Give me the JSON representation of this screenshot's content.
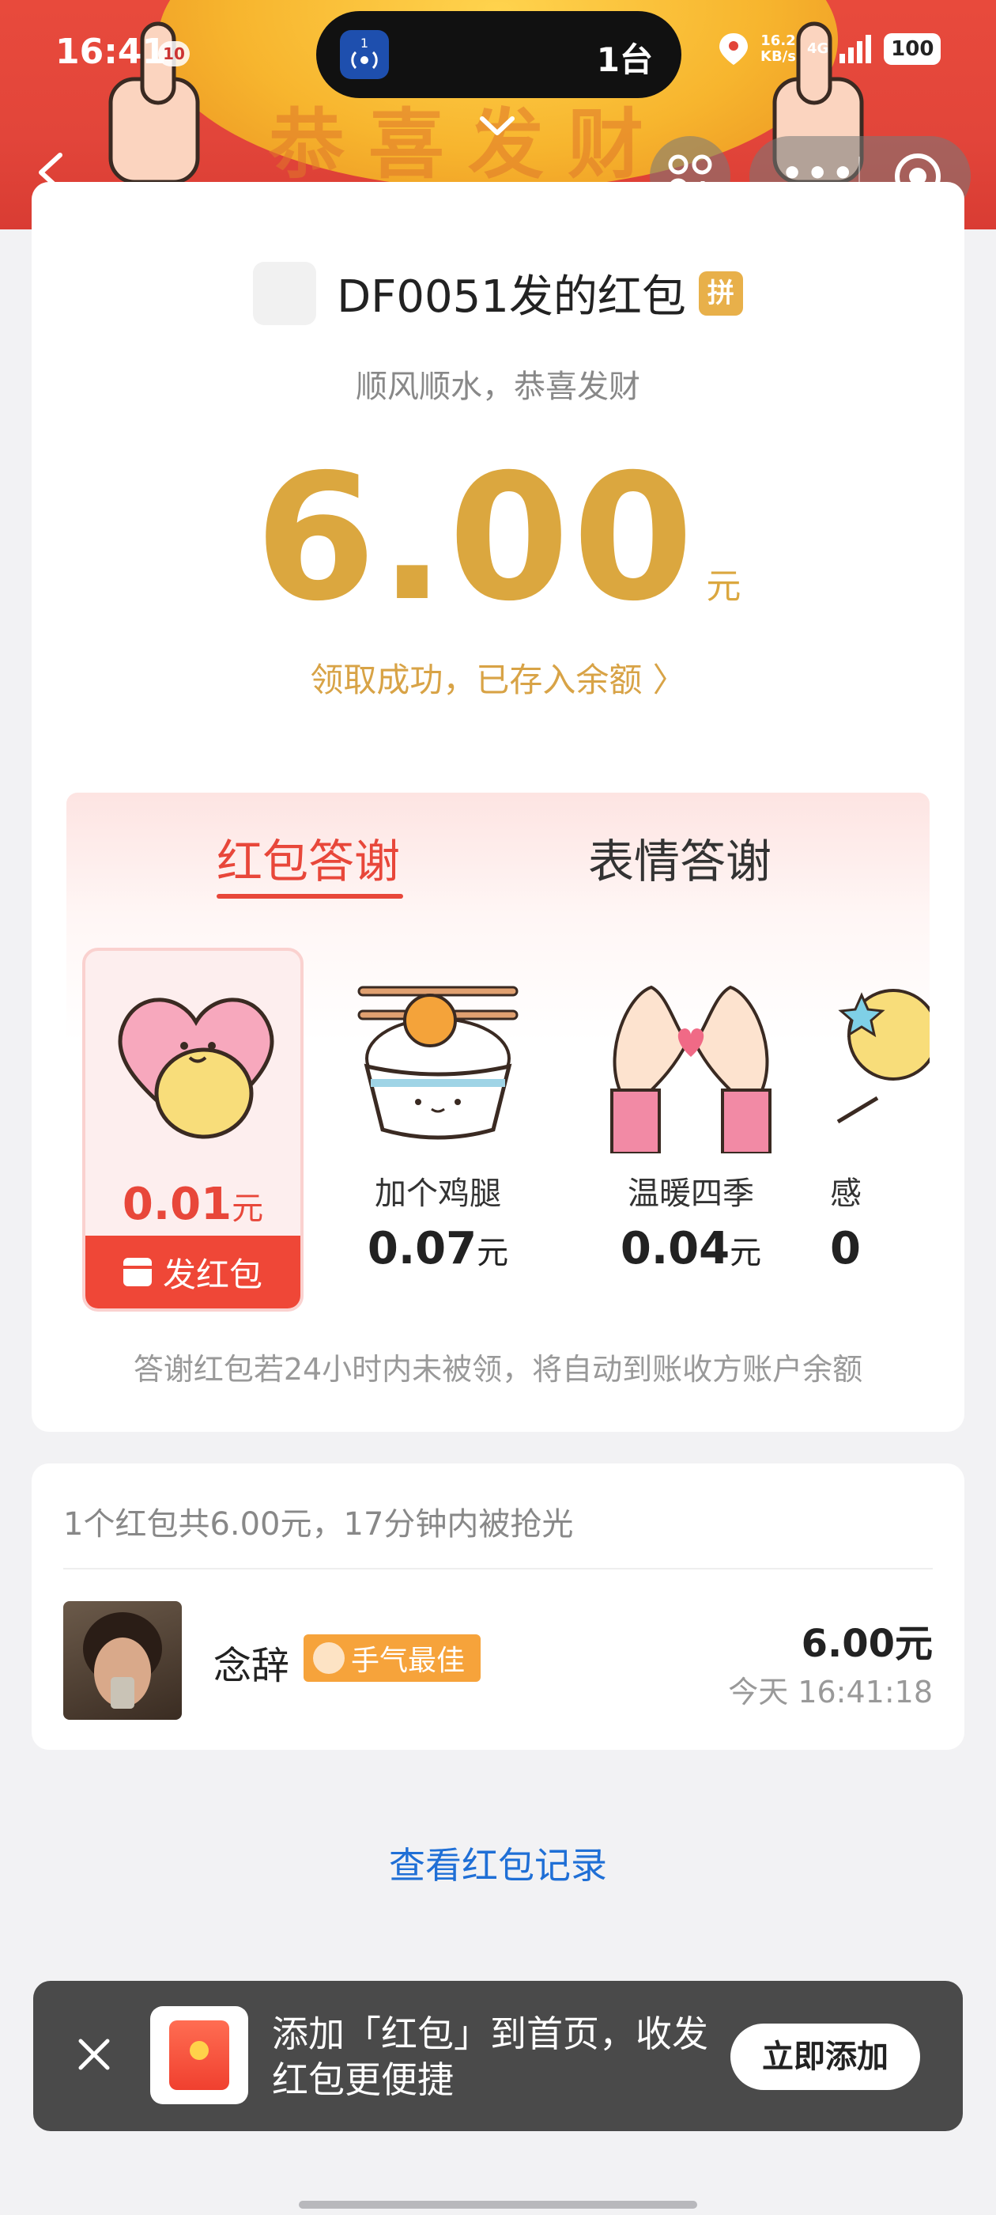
{
  "status_bar": {
    "time": "16:41",
    "notification_badge": "10",
    "island_text": "1台",
    "island_app_badge": "1",
    "net_speed": "16.2",
    "net_speed_unit": "KB/s",
    "network": "4G",
    "battery": "100"
  },
  "banner": {
    "text": "恭喜发财"
  },
  "sender": {
    "name": "DF0051发的红包",
    "badge": "拼",
    "blessing": "顺风顺水，恭喜发财"
  },
  "amount": {
    "value": "6.00",
    "unit": "元",
    "status": "领取成功，已存入余额 〉"
  },
  "thanks": {
    "tabs": [
      "红包答谢",
      "表情答谢"
    ],
    "active_tab": 0,
    "gifts": [
      {
        "name": "",
        "price": "0.01",
        "unit": "元",
        "action": "发红包",
        "selected": true
      },
      {
        "name": "加个鸡腿",
        "price": "0.07",
        "unit": "元"
      },
      {
        "name": "温暖四季",
        "price": "0.04",
        "unit": "元"
      },
      {
        "name": "感",
        "price": "0",
        "unit": ""
      }
    ],
    "note": "答谢红包若24小时内未被领，将自动到账收方账户余额"
  },
  "records": {
    "summary": "1个红包共6.00元，17分钟内被抢光",
    "items": [
      {
        "name": "念辞",
        "badge": "手气最佳",
        "amount": "6.00元",
        "time": "今天 16:41:18"
      }
    ]
  },
  "view_records_link": "查看红包记录",
  "toast": {
    "text": "添加「红包」到首页，收发红包更便捷",
    "button": "立即添加"
  },
  "colors": {
    "accent_red": "#e8473a",
    "gold": "#dba73f",
    "link_blue": "#1f6fd6"
  }
}
